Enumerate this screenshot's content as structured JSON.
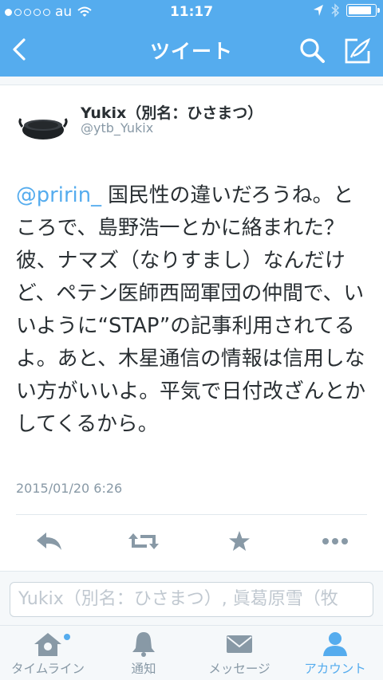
{
  "status_bar": {
    "carrier": "au",
    "time": "11:17"
  },
  "nav": {
    "title": "ツイート",
    "back_icon": "chevron-left-icon",
    "search_icon": "search-icon",
    "compose_icon": "compose-icon"
  },
  "tweet": {
    "name": "Yukix（別名：ひさまつ）",
    "handle": "@ytb_Yukix",
    "mention": "@pririn_",
    "text": " 国民性の違いだろうね。ところで、島野浩一とかに絡まれた？彼、ナマズ（なりすまし）なんだけど、ペテン医師西岡軍団の仲間で、いいように“STAP”の記事利用されてるよ。あと、木星通信の情報は信用しない方がいいよ。平気で日付改ざんとかしてくるから。",
    "timestamp": "2015/01/20 6:26"
  },
  "actions": {
    "reply_icon": "reply-icon",
    "retweet_icon": "retweet-icon",
    "favorite_icon": "star-icon",
    "more_icon": "more-icon"
  },
  "reply": {
    "placeholder": "Yukix（別名：ひさまつ）, 眞葛原雪（牧"
  },
  "tabs": [
    {
      "label": "タイムライン",
      "icon": "home-icon"
    },
    {
      "label": "通知",
      "icon": "bell-icon"
    },
    {
      "label": "メッセージ",
      "icon": "envelope-icon"
    },
    {
      "label": "アカウント",
      "icon": "person-icon"
    }
  ],
  "colors": {
    "accent": "#55acee",
    "text": "#292f33",
    "secondary": "#8899a6"
  }
}
